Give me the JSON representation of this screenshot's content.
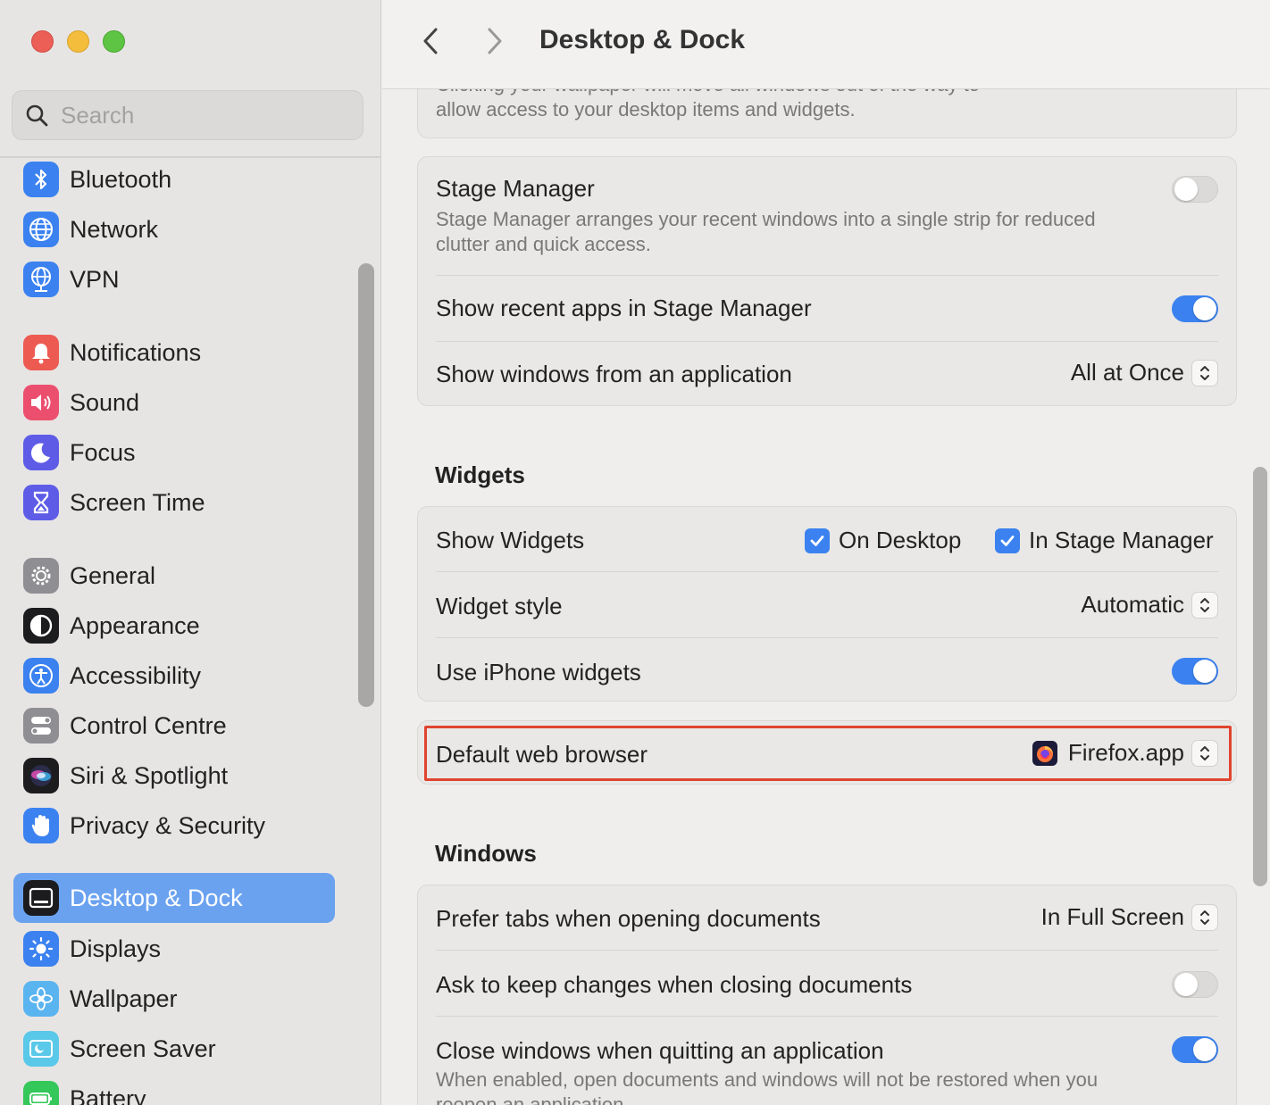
{
  "window": {
    "title": "Desktop & Dock"
  },
  "search": {
    "placeholder": "Search"
  },
  "sidebar": {
    "items": [
      {
        "label": "Bluetooth",
        "icon": "bluetooth-icon"
      },
      {
        "label": "Network",
        "icon": "globe-icon"
      },
      {
        "label": "VPN",
        "icon": "vpn-globe-icon"
      },
      {
        "label": "Notifications",
        "icon": "bell-icon"
      },
      {
        "label": "Sound",
        "icon": "speaker-icon"
      },
      {
        "label": "Focus",
        "icon": "moon-icon"
      },
      {
        "label": "Screen Time",
        "icon": "hourglass-icon"
      },
      {
        "label": "General",
        "icon": "gear-icon"
      },
      {
        "label": "Appearance",
        "icon": "appearance-icon"
      },
      {
        "label": "Accessibility",
        "icon": "accessibility-icon"
      },
      {
        "label": "Control Centre",
        "icon": "toggles-icon"
      },
      {
        "label": "Siri & Spotlight",
        "icon": "siri-icon"
      },
      {
        "label": "Privacy & Security",
        "icon": "hand-icon"
      },
      {
        "label": "Desktop & Dock",
        "icon": "dock-icon",
        "active": true
      },
      {
        "label": "Displays",
        "icon": "sun-icon"
      },
      {
        "label": "Wallpaper",
        "icon": "flower-icon"
      },
      {
        "label": "Screen Saver",
        "icon": "screen-saver-icon"
      },
      {
        "label": "Battery",
        "icon": "battery-icon"
      }
    ]
  },
  "main": {
    "top_desc_line1": "Clicking your wallpaper will move all windows out of the way to",
    "top_desc_line2": "allow access to your desktop items and widgets.",
    "stage_manager": {
      "label": "Stage Manager",
      "desc_line1": "Stage Manager arranges your recent windows into a single strip for reduced",
      "desc_line2": "clutter and quick access.",
      "enabled": false
    },
    "show_recent_apps": {
      "label": "Show recent apps in Stage Manager",
      "enabled": true
    },
    "show_windows": {
      "label": "Show windows from an application",
      "value": "All at Once"
    },
    "widgets_title": "Widgets",
    "show_widgets": {
      "label": "Show Widgets",
      "on_desktop": "On Desktop",
      "in_stage_manager": "In Stage Manager"
    },
    "widget_style": {
      "label": "Widget style",
      "value": "Automatic"
    },
    "iphone_widgets": {
      "label": "Use iPhone widgets",
      "enabled": true
    },
    "default_browser": {
      "label": "Default web browser",
      "value": "Firefox.app",
      "icon": "firefox-icon"
    },
    "windows_title": "Windows",
    "prefer_tabs": {
      "label": "Prefer tabs when opening documents",
      "value": "In Full Screen"
    },
    "ask_keep_changes": {
      "label": "Ask to keep changes when closing documents",
      "enabled": false
    },
    "close_windows": {
      "label": "Close windows when quitting an application",
      "desc_line1": "When enabled, open documents and windows will not be restored when you",
      "desc_line2": "reopen an application.",
      "enabled": true
    }
  },
  "colors": {
    "accent": "#3b82f0",
    "sidebar_active": "#6aa2f0",
    "highlight_box": "#e0442f"
  }
}
